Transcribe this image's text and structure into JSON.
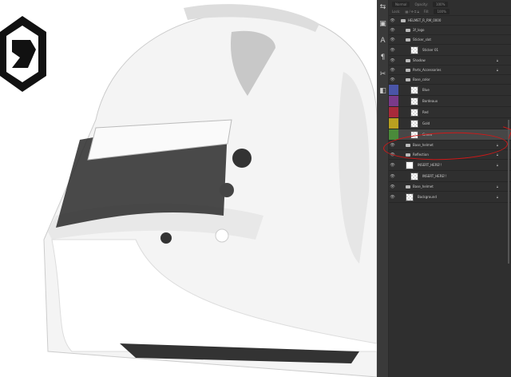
{
  "panel": {
    "blend_mode": "Normal",
    "opacity_label": "Opacity:",
    "opacity": "100%",
    "lock_label": "Lock:",
    "fill_label": "Fill:",
    "fill": "100%",
    "layers": [
      {
        "name": "HELMET_R_RM_0000",
        "type": "group",
        "indent": 0
      },
      {
        "name": "3f_logo",
        "type": "group",
        "indent": 1
      },
      {
        "name": "Sticker_slot",
        "type": "group",
        "indent": 1
      },
      {
        "name": "Sticker 01",
        "type": "layer",
        "indent": 2
      },
      {
        "name": "Shadow",
        "type": "group",
        "indent": 1,
        "locked": true
      },
      {
        "name": "Parts_Accessories",
        "type": "group",
        "indent": 1,
        "locked": true
      },
      {
        "name": "Base_color",
        "type": "group",
        "indent": 1
      },
      {
        "name": "Blue",
        "type": "layer",
        "indent": 2,
        "color": "#4a55a8"
      },
      {
        "name": "Bordeaux",
        "type": "layer",
        "indent": 2,
        "color": "#7a3a8a"
      },
      {
        "name": "Red",
        "type": "layer",
        "indent": 2,
        "color": "#a82a3a"
      },
      {
        "name": "Gold",
        "type": "layer",
        "indent": 2,
        "color": "#b8a020"
      },
      {
        "name": "Green",
        "type": "layer",
        "indent": 2,
        "color": "#4a8a3a",
        "selected": true
      },
      {
        "name": "Base_helmet",
        "type": "group",
        "indent": 1,
        "locked": true
      },
      {
        "name": "Reflection",
        "type": "group",
        "indent": 1,
        "locked": true
      },
      {
        "name": "INSERT_HERE!!",
        "type": "smart",
        "indent": 1,
        "locked": true
      },
      {
        "name": "INSERT_HERE!!",
        "type": "layer",
        "indent": 2
      },
      {
        "name": "Base_helmet",
        "type": "group",
        "indent": 1,
        "locked": true
      },
      {
        "name": "Background",
        "type": "layer",
        "indent": 1,
        "locked": true
      }
    ]
  },
  "annotation_color": "#d01818"
}
